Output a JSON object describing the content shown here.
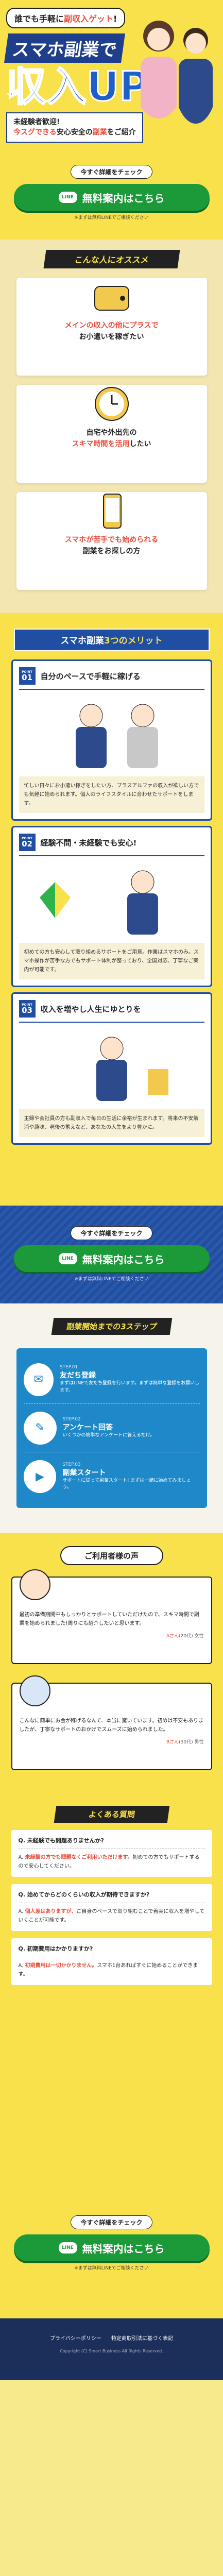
{
  "hero": {
    "tag_pre": "誰でも手軽に",
    "tag_emph": "副収入ゲット",
    "tag_post": "!",
    "line1": "スマホ副業で",
    "line2": "収入UP",
    "sub1": "未経験者歓迎!",
    "sub2_red": "今スグできる",
    "sub2_mid": "安心安全の",
    "sub2_red2": "副業",
    "sub2_post": "をご紹介"
  },
  "cta": {
    "pre": "今すぐ詳細をチェック",
    "button": "無料案内はこちら",
    "line_label": "LINE",
    "note": "※まずは無料LINEでご相談ください"
  },
  "recommend": {
    "title": "こんな人にオススメ",
    "cards": [
      {
        "l1_red": "メインの収入の他にプラスで",
        "l2": "お小遣いを稼ぎたい"
      },
      {
        "l1": "自宅や外出先の",
        "l2_red": "スキマ時間を活用",
        "l2": "したい"
      },
      {
        "l1_red": "スマホが苦手でも始められる",
        "l2": "副業をお探しの方"
      }
    ]
  },
  "merits": {
    "title_pre": "スマホ副業",
    "title_emph": "3つのメリット",
    "items": [
      {
        "num": "01",
        "head": "自分のペースで手軽に稼げる",
        "body": "忙しい日々にお小遣い稼ぎをしたい方、プラスアルファの収入が欲しい方でも気軽に始められます。個人のライフスタイルに合わせたサポートをします。"
      },
      {
        "num": "02",
        "head": "経験不問・未経験でも安心!",
        "body": "初めての方も安心して取り組めるサポートをご用意。作業はスマホのみ。スマホ操作が苦手な方でもサポート体制が整っており、全国対応、丁寧なご案内が可能です。"
      },
      {
        "num": "03",
        "head": "収入を増やし人生にゆとりを",
        "body": "主婦や会社員の方も副収入で毎日の生活に余裕が生まれます。将来の不安解消や趣味、老後の蓄えなど、あなたの人生をより豊かに。"
      }
    ]
  },
  "steps": {
    "title": "副業開始までの3ステップ",
    "items": [
      {
        "step": "STEP.01",
        "title": "友だち登録",
        "desc": "まずはLINEで友だち登録を行います。まずは簡単な登録をお願いします。"
      },
      {
        "step": "STEP.02",
        "title": "アンケート回答",
        "desc": "いくつかの簡単なアンケートに答えるだけ。"
      },
      {
        "step": "STEP.03",
        "title": "副業スタート",
        "desc": "サポートに従って副業スタート! まずは一緒に始めてみましょう。"
      }
    ]
  },
  "voice": {
    "title": "ご利用者様の声",
    "items": [
      {
        "text": "最初の準備期間中もしっかりとサポートしていただけたので、スキマ時間で副業を始められました!周りにも紹介したいと思います。",
        "who_red": "Aさん",
        "who": "(20代) 女性"
      },
      {
        "text": "こんなに簡単にお金が稼げるなんて、本当に驚いています。初めは不安もありましたが、丁寧なサポートのおかげでスムーズに始められました。",
        "who_red": "Bさん",
        "who": "(30代) 男性"
      }
    ]
  },
  "faq": {
    "title": "よくある質問",
    "items": [
      {
        "q": "Q. 未経験でも問題ありませんか?",
        "a_pre": "A. ",
        "a_red": "未経験の方でも問題なくご利用いただけます。",
        "a_post": "初めての方でもサポートするので安心してください。"
      },
      {
        "q": "Q. 始めてからどのくらいの収入が期待できますか?",
        "a_pre": "A. ",
        "a_red": "個人差はありますが、",
        "a_post": "ご自身のペースで取り組むことで着実に収入を増やしていくことが可能です。"
      },
      {
        "q": "Q. 初期費用はかかりますか?",
        "a_pre": "A. ",
        "a_red": "初期費用は一切かかりません。",
        "a_post": "スマホ1台あればすぐに始めることができます。"
      }
    ]
  },
  "footer": {
    "links": [
      "プライバシーポリシー",
      "特定商取引法に基づく表記"
    ],
    "copy": "Copyright (C) Smart Business All Rights Reserved."
  },
  "colors": {
    "yellow": "#f8e14a",
    "navy": "#1f4ea3",
    "green": "#1c9a3a",
    "red": "#e94d3a"
  }
}
